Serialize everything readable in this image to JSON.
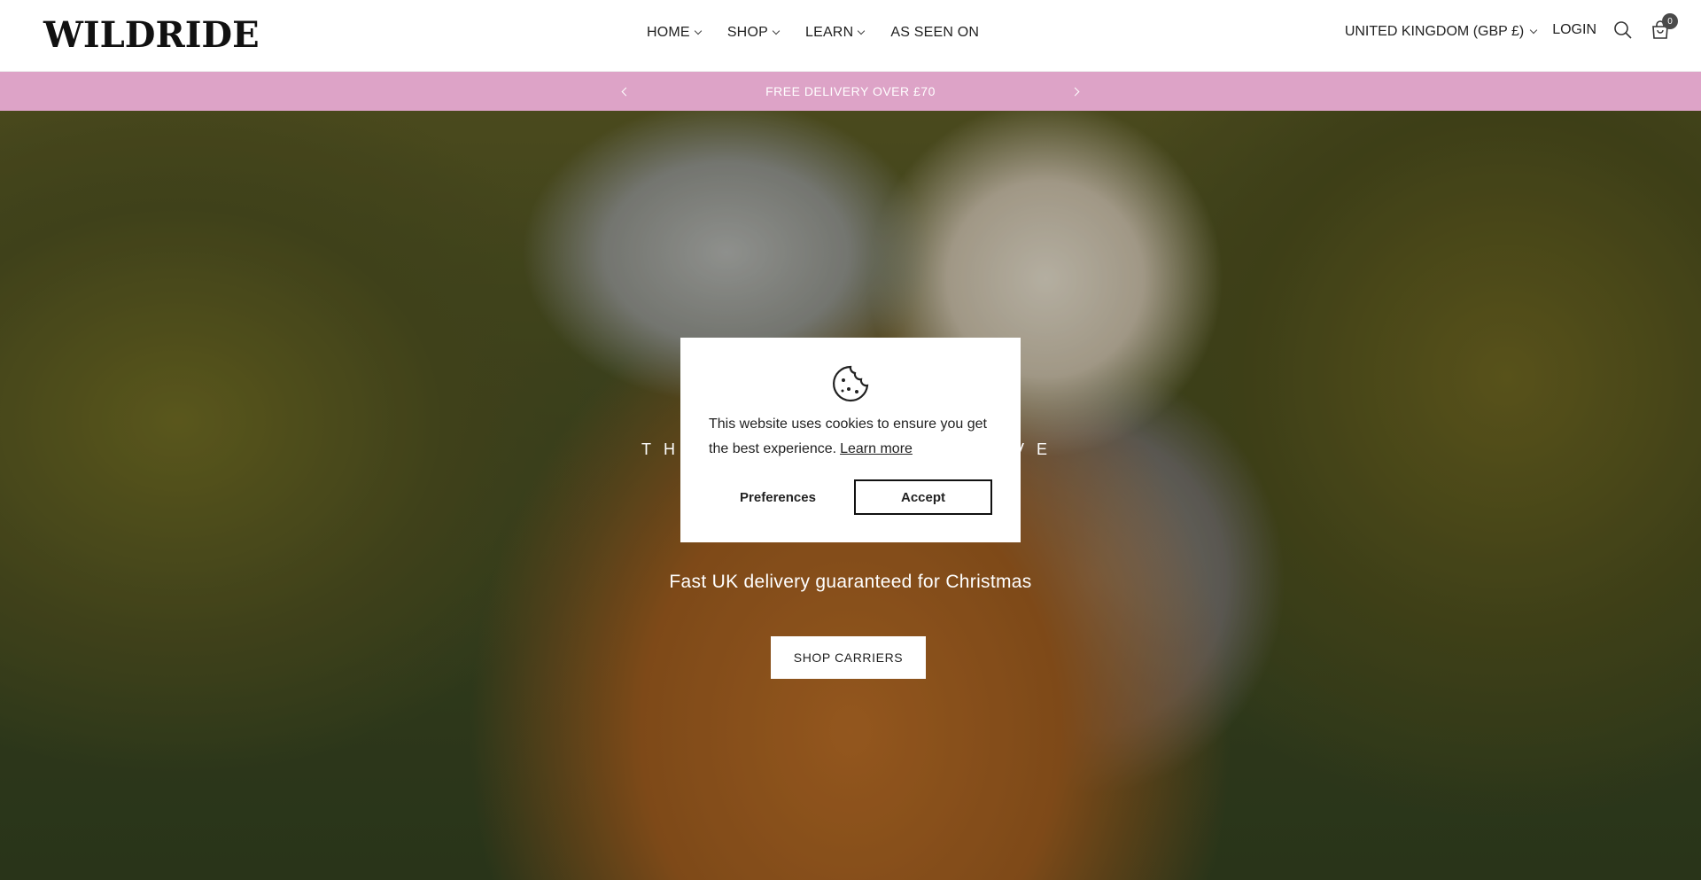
{
  "header": {
    "logo": "WILDRIDE",
    "nav": [
      {
        "label": "HOME",
        "has_dropdown": true
      },
      {
        "label": "SHOP",
        "has_dropdown": true
      },
      {
        "label": "LEARN",
        "has_dropdown": true
      },
      {
        "label": "AS SEEN ON",
        "has_dropdown": false
      }
    ],
    "country": "UNITED KINGDOM (GBP £)",
    "login": "LOGIN",
    "search_icon": "search-icon",
    "cart_icon": "cart-icon",
    "cart_count": "0"
  },
  "announcement": {
    "text": "FREE DELIVERY OVER £70",
    "background": "#dda3c7"
  },
  "hero": {
    "tagline": "TH",
    "tagline_end": "VE",
    "subtitle": "Fast UK delivery guaranteed for Christmas",
    "button": "SHOP CARRIERS"
  },
  "cookie": {
    "icon": "cookie-icon",
    "message": "This website uses cookies to ensure you get the best experience.",
    "learn_more": "Learn more",
    "preferences": "Preferences",
    "accept": "Accept"
  }
}
